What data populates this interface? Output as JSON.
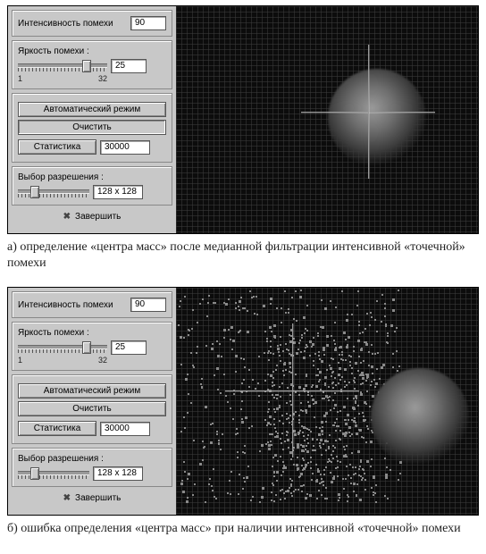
{
  "panelA": {
    "intensity": {
      "label": "Интенсивность помехи",
      "value": "90"
    },
    "brightness": {
      "label": "Яркость помехи :",
      "value": "25",
      "scale_min": "1",
      "scale_max": "32"
    },
    "auto_button": "Автоматический режим",
    "clear_button": "Очистить",
    "stats_button": "Статистика",
    "stats_value": "30000",
    "resolution_label": "Выбор разрешения :",
    "resolution_value": "128 x 128",
    "finish_button": "Завершить",
    "finish_icon": "✖"
  },
  "panelB": {
    "intensity": {
      "label": "Интенсивность помехи",
      "value": "90"
    },
    "brightness": {
      "label": "Яркость помехи :",
      "value": "25",
      "scale_min": "1",
      "scale_max": "32"
    },
    "auto_button": "Автоматический режим",
    "clear_button": "Очистить",
    "stats_button": "Статистика",
    "stats_value": "30000",
    "resolution_label": "Выбор разрешения :",
    "resolution_value": "128 x 128",
    "finish_button": "Завершить",
    "finish_icon": "✖"
  },
  "captions": {
    "a": "а) определение «центра масс» после медианной фильтрации интенсивной «точечной» помехи",
    "b": "б) ошибка определения «центра масс» при наличии интенсивной «точечной» помехи"
  }
}
